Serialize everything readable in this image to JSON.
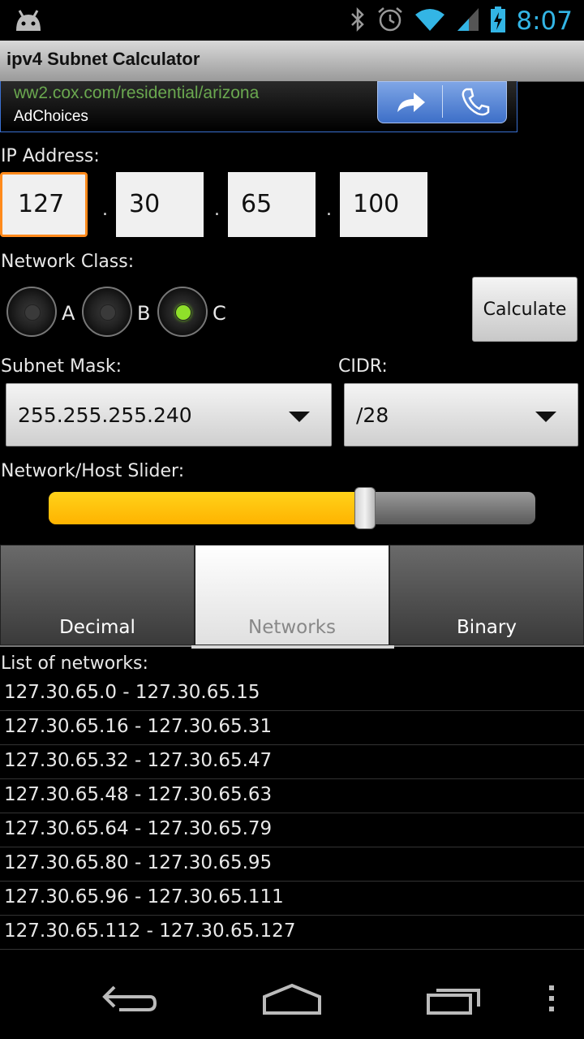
{
  "status_bar": {
    "time": "8:07",
    "icons": [
      "android-icon",
      "bluetooth-icon",
      "alarm-icon",
      "wifi-icon",
      "signal-icon",
      "battery-charging-icon"
    ],
    "time_color": "#33b5e5"
  },
  "app": {
    "title": "ipv4 Subnet Calculator"
  },
  "ad": {
    "url": "ww2.cox.com/residential/arizona",
    "choices": "AdChoices",
    "icons": [
      "share-arrow-icon",
      "phone-icon"
    ]
  },
  "ip": {
    "label": "IP Address:",
    "octets": [
      "127",
      "30",
      "65",
      "100"
    ],
    "separator": "."
  },
  "network_class": {
    "label": "Network Class:",
    "options": [
      "A",
      "B",
      "C"
    ],
    "selected": "C"
  },
  "calculate_label": "Calculate",
  "subnet_mask": {
    "label": "Subnet Mask:",
    "value": "255.255.255.240"
  },
  "cidr": {
    "label": "CIDR:",
    "value": "/28"
  },
  "slider": {
    "label": "Network/Host Slider:",
    "fraction": 0.65
  },
  "tabs": [
    {
      "label": "Decimal",
      "selected": false
    },
    {
      "label": "Networks",
      "selected": true
    },
    {
      "label": "Binary",
      "selected": false
    }
  ],
  "networks": {
    "label": "List of networks:",
    "items": [
      "127.30.65.0 - 127.30.65.15",
      "127.30.65.16 - 127.30.65.31",
      "127.30.65.32 - 127.30.65.47",
      "127.30.65.48 - 127.30.65.63",
      "127.30.65.64 - 127.30.65.79",
      "127.30.65.80 - 127.30.65.95",
      "127.30.65.96 - 127.30.65.111",
      "127.30.65.112 - 127.30.65.127"
    ]
  },
  "nav": [
    "back-icon",
    "home-icon",
    "recent-apps-icon",
    "overflow-menu-icon"
  ],
  "colors": {
    "accent": "#ffb300",
    "focus": "#ff8a1c",
    "radio_on": "#8fe02a"
  }
}
